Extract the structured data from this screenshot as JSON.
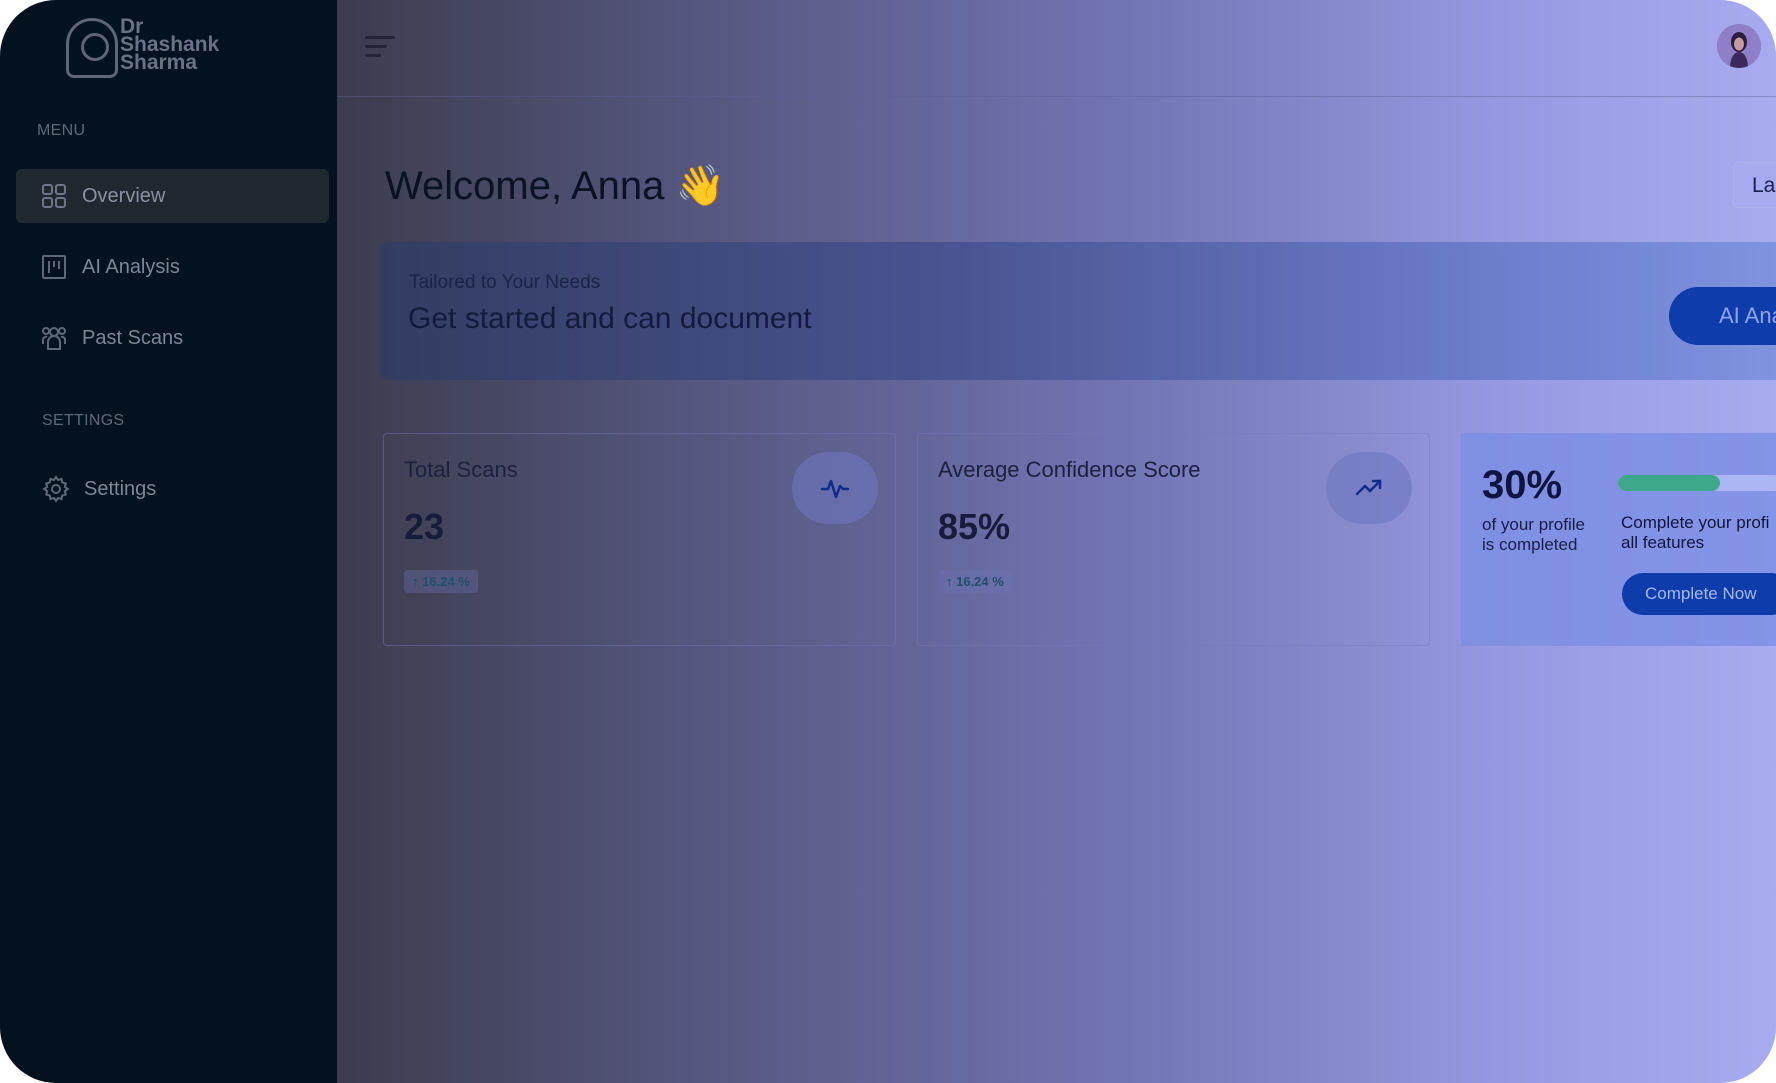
{
  "brand": {
    "line1": "Dr",
    "line2": "Shashank",
    "line3": "Sharma"
  },
  "sidebar": {
    "menu_label": "MENU",
    "settings_label": "SETTINGS",
    "items": [
      {
        "label": "Overview",
        "icon": "grid-icon",
        "active": true
      },
      {
        "label": "AI Analysis",
        "icon": "kanban-icon",
        "active": false
      },
      {
        "label": "Past Scans",
        "icon": "users-icon",
        "active": false
      }
    ],
    "settings_items": [
      {
        "label": "Settings",
        "icon": "gear-icon"
      }
    ]
  },
  "header": {
    "menu_icon": "hamburger-icon",
    "avatar": "user-avatar"
  },
  "welcome": {
    "text": "Welcome, Anna 👋"
  },
  "last_button": {
    "label": "Las"
  },
  "banner": {
    "subtitle": "Tailored to Your Needs",
    "title": "Get started and can document",
    "button_label": "AI Analysis"
  },
  "stats": [
    {
      "title": "Total Scans",
      "value": "23",
      "change": "↑ 16.24 %",
      "icon": "activity-icon"
    },
    {
      "title": "Average Confidence Score",
      "value": "85%",
      "change": "↑ 16.24 %",
      "icon": "trending-up-icon"
    }
  ],
  "profile": {
    "percent_label": "30%",
    "progress": 0.3,
    "sub_line1": "of your profile",
    "sub_line2": "is completed",
    "msg_line1": "Complete your profi",
    "msg_line2": "all features",
    "button_label": "Complete Now"
  },
  "colors": {
    "sidebar_bg": "#04121f",
    "primary_button": "#0e3dab",
    "progress_fill": "#3ea98a"
  }
}
